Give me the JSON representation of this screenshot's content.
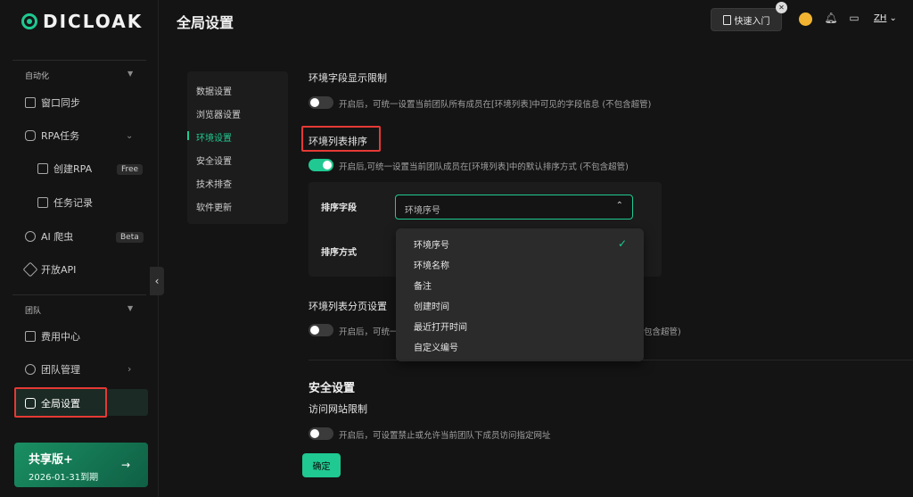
{
  "app": {
    "logo_text": "DICLOAK",
    "page_title": "全局设置"
  },
  "header": {
    "quick_start": "快速入门",
    "lang": "ZH",
    "close": "✕"
  },
  "sidebar": {
    "section_automation": "自动化",
    "items": {
      "window_sync": "窗口同步",
      "rpa": "RPA任务",
      "create_rpa": "创建RPA",
      "create_rpa_badge": "Free",
      "task_log": "任务记录",
      "ai_crawler": "AI 爬虫",
      "ai_crawler_badge": "Beta",
      "open_api": "开放API",
      "billing": "费用中心",
      "team_mgmt": "团队管理",
      "global_settings": "全局设置"
    },
    "section_team": "团队",
    "promo": {
      "title": "共享版+",
      "date": "2026-01-31到期",
      "arrow": "→"
    }
  },
  "subnav": {
    "items": [
      "数据设置",
      "浏览器设置",
      "环境设置",
      "安全设置",
      "技术排查",
      "软件更新"
    ]
  },
  "main": {
    "field_limit": {
      "title": "环境字段显示限制",
      "desc": "开启后，可统一设置当前团队所有成员在[环境列表]中可见的字段信息 (不包含超管)",
      "enabled": false
    },
    "list_sort": {
      "title": "环境列表排序",
      "desc": "开启后,可统一设置当前团队成员在[环境列表]中的默认排序方式 (不包含超管)",
      "enabled": true,
      "field_label": "排序字段",
      "field_value": "环境序号",
      "method_label": "排序方式",
      "options": [
        "环境序号",
        "环境名称",
        "备注",
        "创建时间",
        "最近打开时间",
        "自定义编号"
      ],
      "selected_option": "环境序号"
    },
    "pagination": {
      "title": "环境列表分页设置",
      "desc_left": "开启后，可统一",
      "desc_right": "包含超管)",
      "enabled": false
    },
    "security": {
      "title": "安全设置",
      "site_limit_title": "访问网站限制",
      "site_limit_desc": "开启后，可设置禁止或允许当前团队下成员访问指定网址",
      "enabled": false
    },
    "confirm": "确定"
  },
  "colors": {
    "accent": "#1fc991",
    "highlight": "#e53935",
    "bg": "#141414"
  }
}
